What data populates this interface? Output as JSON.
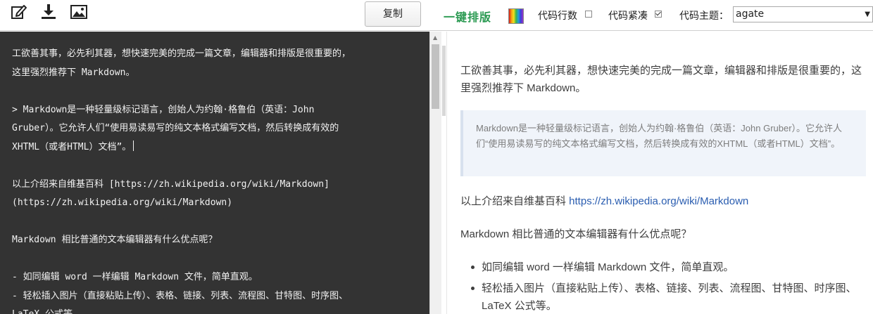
{
  "toolbar": {
    "copy_label": "复制",
    "format_label": "一键排版",
    "line_numbers_label": "代码行数",
    "line_numbers_checked": false,
    "compact_label": "代码紧凑",
    "compact_checked": true,
    "theme_label": "代码主题：",
    "theme_value": "agate",
    "icons": [
      "edit-icon",
      "download-icon",
      "image-icon",
      "color-palette-icon"
    ]
  },
  "editor": {
    "lines": [
      "工欲善其事，必先利其器，想快速完美的完成一篇文章，编辑器和排版是很重要的，",
      "这里强烈推荐下 Markdown。",
      "",
      "> Markdown是一种轻量级标记语言，创始人为约翰·格鲁伯（英语：John",
      "Gruber）。它允许人们“使用易读易写的纯文本格式编写文档，然后转换成有效的",
      "XHTML（或者HTML）文档”。",
      "",
      "以上介绍来自维基百科 [https://zh.wikipedia.org/wiki/Markdown]",
      "(https://zh.wikipedia.org/wiki/Markdown)",
      "",
      "Markdown 相比普通的文本编辑器有什么优点呢？",
      "",
      "- 如同编辑 word 一样编辑 Markdown 文件，简单直观。",
      "- 轻松插入图片（直接粘贴上传）、表格、链接、列表、流程图、甘特图、时序图、",
      "  LaTeX 公式等。"
    ]
  },
  "preview": {
    "intro": "工欲善其事，必先利其器，想快速完美的完成一篇文章，编辑器和排版是很重要的，这里强烈推荐下 Markdown。",
    "quote": "Markdown是一种轻量级标记语言，创始人为约翰·格鲁伯（英语：John Gruber）。它允许人们“使用易读易写的纯文本格式编写文档，然后转换成有效的XHTML（或者HTML）文档”。",
    "source_prefix": "以上介绍来自维基百科 ",
    "source_link": "https://zh.wikipedia.org/wiki/Markdown",
    "question": "Markdown 相比普通的文本编辑器有什么优点呢？",
    "list": [
      "如同编辑 word 一样编辑 Markdown 文件，简单直观。",
      "轻松插入图片（直接粘贴上传）、表格、链接、列表、流程图、甘特图、时序图、LaTeX 公式等。"
    ]
  }
}
